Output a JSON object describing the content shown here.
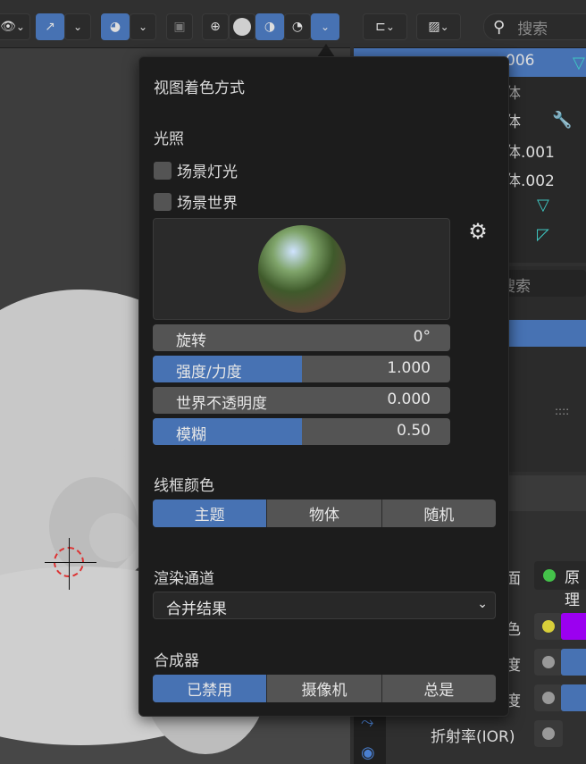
{
  "popover": {
    "title": "视图着色方式",
    "lighting": {
      "label": "光照",
      "scene_lights": "场景灯光",
      "scene_world": "场景世界"
    },
    "sliders": [
      {
        "label": "旋转",
        "value": "0°",
        "fill": 0
      },
      {
        "label": "强度/力度",
        "value": "1.000",
        "fill": 0.5
      },
      {
        "label": "世界不透明度",
        "value": "0.000",
        "fill": 0
      },
      {
        "label": "模糊",
        "value": "0.50",
        "fill": 0.5
      }
    ],
    "wireframe": {
      "label": "线框颜色",
      "options": [
        "主题",
        "物体",
        "随机"
      ],
      "selected": "主题"
    },
    "render_pass": {
      "label": "渲染通道",
      "value": "合并结果"
    },
    "compositor": {
      "label": "合成器",
      "options": [
        "已禁用",
        "摄像机",
        "总是"
      ],
      "selected": "已禁用"
    }
  },
  "outliner": {
    "search_placeholder": "搜索",
    "rows": [
      "006",
      "体",
      "体",
      "体.001",
      "体.002"
    ]
  },
  "properties": {
    "search_placeholder": "搜索",
    "labels": [
      "面",
      "色",
      "度",
      "度",
      "折射率(IOR)"
    ],
    "surface_value": "原理",
    "dots_handle": "::::"
  },
  "colors": {
    "accent": "#4772b3",
    "base_color_swatch": "#9b00f0",
    "surface_dot": "#44c24a",
    "color_dot": "#d8cf3a"
  }
}
